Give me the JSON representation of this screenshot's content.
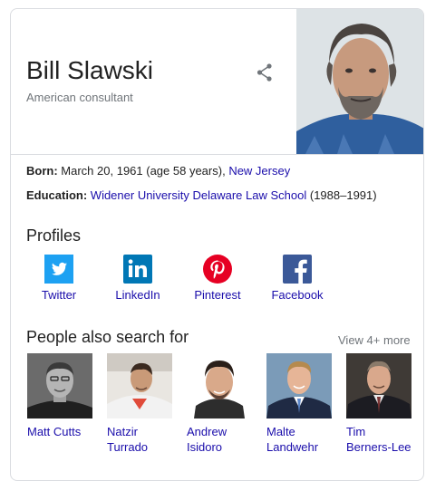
{
  "entity": {
    "name": "Bill Slawski",
    "description": "American consultant",
    "photo_icon": "portrait-photo"
  },
  "facts": [
    {
      "label": "Born:",
      "value": "March 20, 1961 (age 58 years),",
      "link": "New Jersey"
    },
    {
      "label": "Education:",
      "link": "Widener University Delaware Law School",
      "value": "(1988–1991)"
    }
  ],
  "profiles": {
    "title": "Profiles",
    "items": [
      {
        "label": "Twitter",
        "icon": "twitter-icon",
        "color": "#1da1f2"
      },
      {
        "label": "LinkedIn",
        "icon": "linkedin-icon",
        "color": "#0077b5"
      },
      {
        "label": "Pinterest",
        "icon": "pinterest-icon",
        "color": "#e60023"
      },
      {
        "label": "Facebook",
        "icon": "facebook-icon",
        "color": "#3b5998"
      }
    ]
  },
  "people": {
    "title": "People also search for",
    "view_more": "View 4+ more",
    "items": [
      {
        "line1": "Matt Cutts",
        "line2": ""
      },
      {
        "line1": "Natzir",
        "line2": "Turrado"
      },
      {
        "line1": "Andrew",
        "line2": "Isidoro"
      },
      {
        "line1": "Malte",
        "line2": "Landwehr"
      },
      {
        "line1": "Tim",
        "line2": "Berners-Lee"
      }
    ]
  },
  "colors": {
    "link": "#1a0dab",
    "muted": "#70757a",
    "border": "#dadce0"
  }
}
